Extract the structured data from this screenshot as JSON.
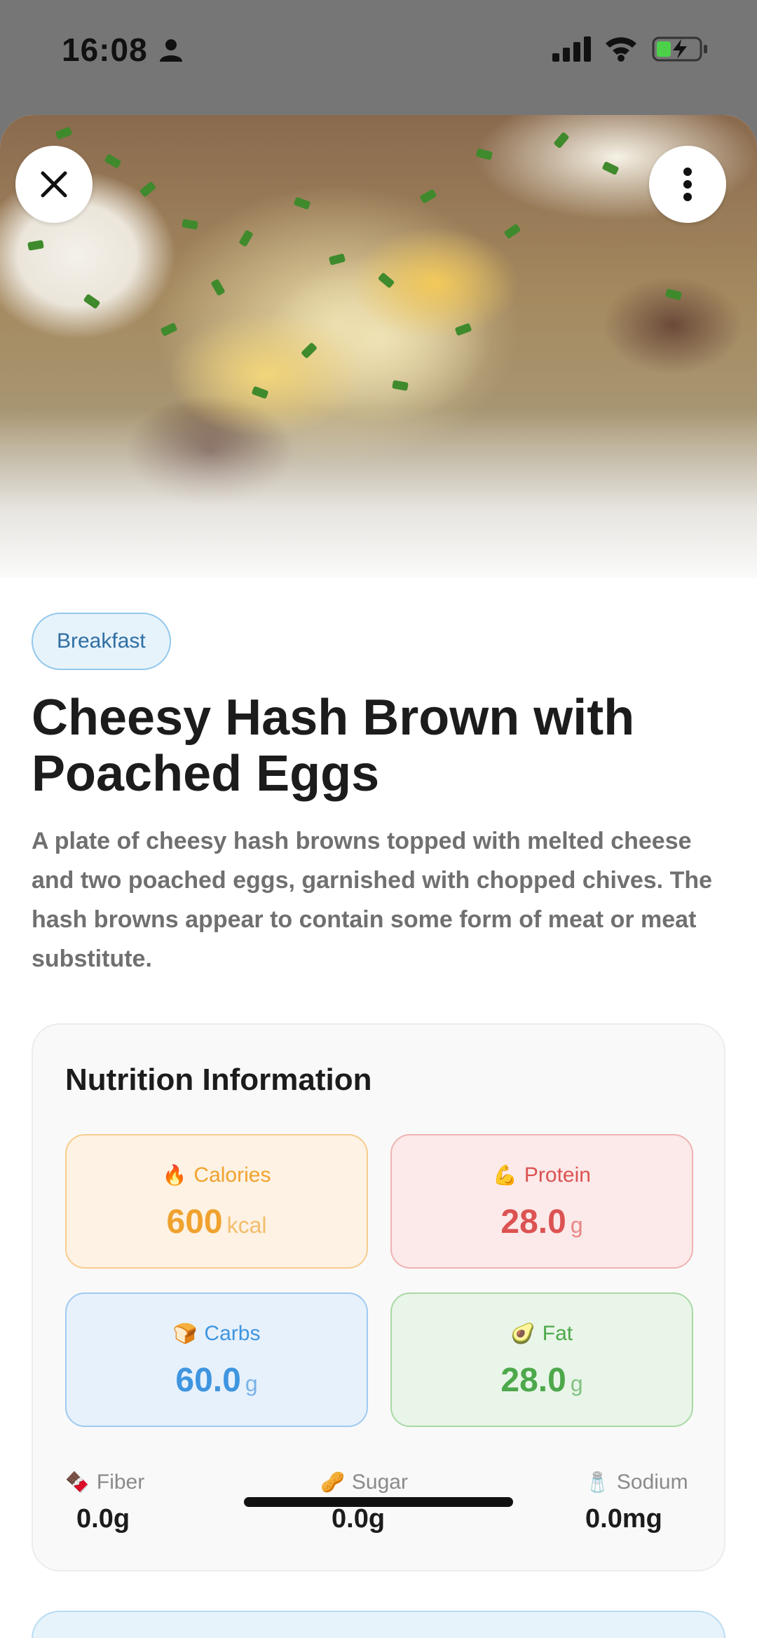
{
  "status_bar": {
    "time": "16:08",
    "icons": [
      "person-icon",
      "signal-icon",
      "wifi-icon",
      "battery-charging-icon"
    ]
  },
  "hero": {
    "close_icon": "close-icon",
    "more_icon": "more-vertical-icon"
  },
  "recipe": {
    "category": "Breakfast",
    "title": "Cheesy Hash Brown with Poached Eggs",
    "description": "A plate of cheesy hash browns topped with melted cheese and two poached eggs, garnished with chopped chives.  The hash browns appear to contain some form of meat or meat substitute."
  },
  "nutrition": {
    "title": "Nutrition Information",
    "calories": {
      "emoji": "🔥",
      "label": "Calories",
      "value": "600",
      "unit": "kcal",
      "color": "#f0a22e"
    },
    "protein": {
      "emoji": "💪",
      "label": "Protein",
      "value": "28.0",
      "unit": "g",
      "color": "#dc5252"
    },
    "carbs": {
      "emoji": "🍞",
      "label": "Carbs",
      "value": "60.0",
      "unit": "g",
      "color": "#3f95df"
    },
    "fat": {
      "emoji": "🥑",
      "label": "Fat",
      "value": "28.0",
      "unit": "g",
      "color": "#4da84b"
    },
    "fiber": {
      "emoji": "🍫",
      "label": "Fiber",
      "value": "0.0g"
    },
    "sugar": {
      "emoji": "🥜",
      "label": "Sugar",
      "value": "0.0g"
    },
    "sodium": {
      "emoji": "🧂",
      "label": "Sodium",
      "value": "0.0mg"
    }
  }
}
